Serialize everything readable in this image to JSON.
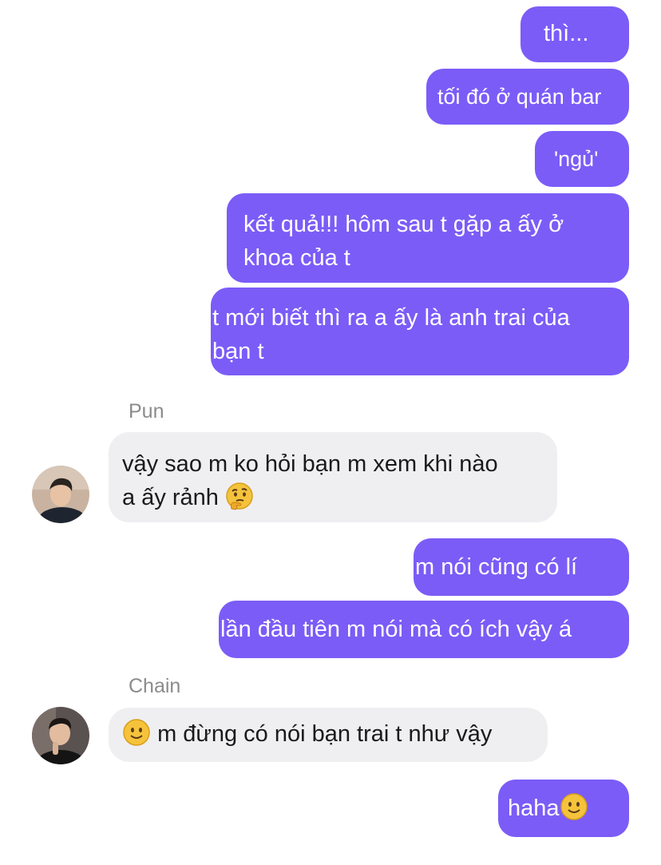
{
  "messages": [
    {
      "type": "out",
      "text": "thì..."
    },
    {
      "type": "out",
      "text": "tối đó ở quán bar"
    },
    {
      "type": "out",
      "text": "'ngủ'"
    },
    {
      "type": "out",
      "lines": [
        "kết quả!!! hôm sau t gặp a ấy ở",
        "khoa của t"
      ]
    },
    {
      "type": "out",
      "lines": [
        "t mới biết thì ra a ấy là anh trai của",
        "bạn t"
      ]
    },
    {
      "type": "in",
      "sender": "Pun",
      "lines": [
        "vậy sao m ko hỏi bạn m xem khi nào",
        "a ấy rảnh"
      ],
      "emoji": "thinking-face"
    },
    {
      "type": "out",
      "text": "m nói cũng có lí"
    },
    {
      "type": "out",
      "text": "lần đầu tiên m nói mà có ích vậy á"
    },
    {
      "type": "in",
      "sender": "Chain",
      "emoji": "slightly-smiling-face",
      "text": "m đừng có nói bạn trai t như vậy"
    },
    {
      "type": "out",
      "text": "haha",
      "emoji": "slightly-smiling-face"
    }
  ],
  "colors": {
    "outgoing_bubble": "#7b5cf7",
    "incoming_bubble": "#efeff2",
    "sender_name": "#8b8b8b"
  }
}
